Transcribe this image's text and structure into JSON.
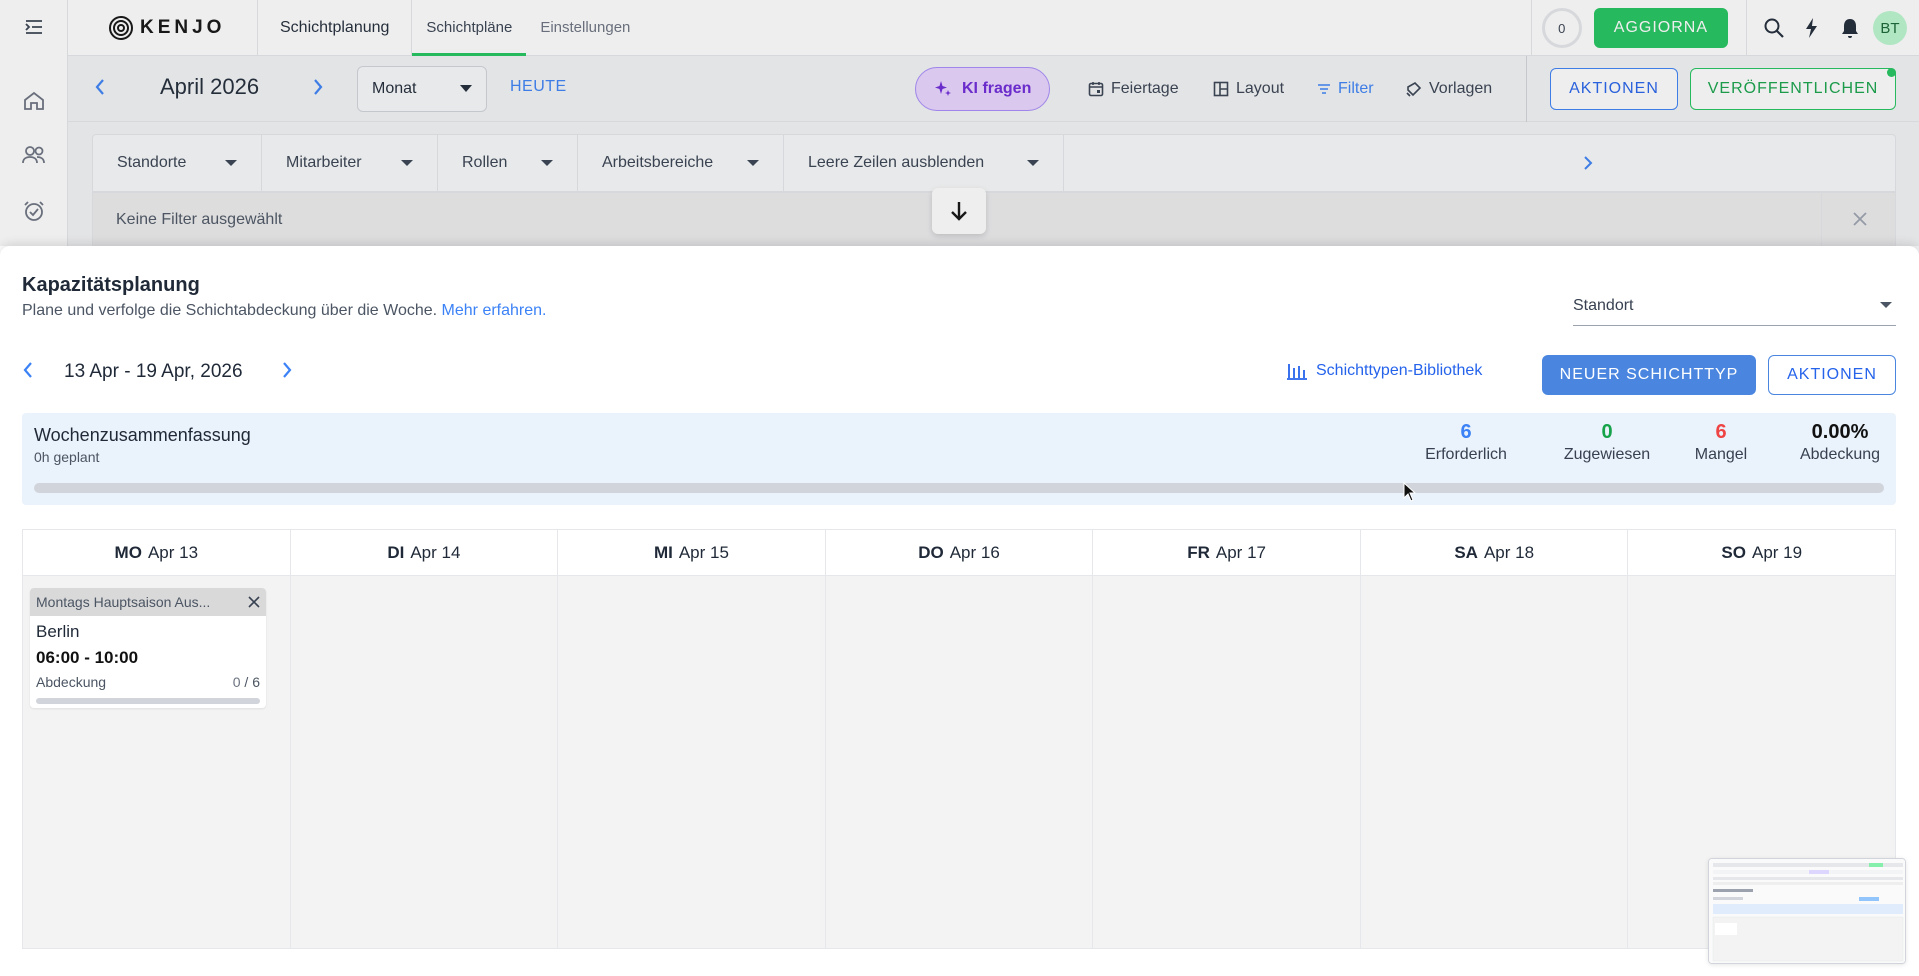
{
  "app": {
    "brand": "KENJO",
    "nav_main": "Schichtplanung",
    "tabs": [
      "Schichtpläne",
      "Einstellungen"
    ],
    "counter": "0",
    "update_label": "AGGIORNA",
    "avatar_initials": "BT"
  },
  "toolbar": {
    "month": "April 2026",
    "view_select": "Monat",
    "today": "HEUTE",
    "ai_label": "KI fragen",
    "holidays": "Feiertage",
    "layout": "Layout",
    "filter": "Filter",
    "templates": "Vorlagen",
    "actions": "AKTIONEN",
    "publish": "VERÖFFENTLICHEN"
  },
  "filters": {
    "dropdowns": [
      "Standorte",
      "Mitarbeiter",
      "Rollen",
      "Arbeitsbereiche",
      "Leere Zeilen ausblenden"
    ],
    "none_selected": "Keine Filter ausgewählt"
  },
  "capacity": {
    "title": "Kapazitätsplanung",
    "subtitle": "Plane und verfolge die Schichtabdeckung über die Woche.",
    "learn_more": "Mehr erfahren.",
    "location_placeholder": "Standort",
    "week_range": "13 Apr - 19 Apr, 2026",
    "library_link": "Schichttypen-Bibliothek",
    "new_shift_type": "NEUER SCHICHTTYP",
    "actions": "AKTIONEN"
  },
  "summary": {
    "title": "Wochenzusammenfassung",
    "planned": "0h geplant",
    "required": {
      "value": "6",
      "label": "Erforderlich"
    },
    "assigned": {
      "value": "0",
      "label": "Zugewiesen"
    },
    "shortage": {
      "value": "6",
      "label": "Mangel"
    },
    "coverage": {
      "value": "0.00%",
      "label": "Abdeckung"
    },
    "coverage_fraction": 0.0
  },
  "calendar": {
    "days": [
      {
        "dow": "MO",
        "date": "Apr 13"
      },
      {
        "dow": "DI",
        "date": "Apr 14"
      },
      {
        "dow": "MI",
        "date": "Apr 15"
      },
      {
        "dow": "DO",
        "date": "Apr 16"
      },
      {
        "dow": "FR",
        "date": "Apr 17"
      },
      {
        "dow": "SA",
        "date": "Apr 18"
      },
      {
        "dow": "SO",
        "date": "Apr 19"
      }
    ],
    "shift": {
      "name": "Montags Hauptsaison Aus...",
      "location": "Berlin",
      "time": "06:00 - 10:00",
      "coverage_label": "Abdeckung",
      "assigned": "0",
      "required": "/ 6",
      "coverage_fraction": 0.0
    }
  },
  "colors": {
    "accent_green": "#22c55e",
    "accent_blue": "#3b82f6",
    "required_blue": "#3b82f6",
    "assigned_green": "#16a34a",
    "shortage_red": "#ef4444",
    "ai_purple": "#6d28d9"
  },
  "icons": [
    "menu-collapse-icon",
    "home-icon",
    "people-icon",
    "alarm-icon",
    "search-icon",
    "bolt-icon",
    "bell-icon",
    "sparkle-icon",
    "calendar-icon",
    "layout-icon",
    "filter-icon",
    "template-icon",
    "chevron-left-icon",
    "chevron-right-icon",
    "caret-down-icon",
    "arrow-down-icon",
    "close-icon",
    "bar-chart-icon"
  ]
}
